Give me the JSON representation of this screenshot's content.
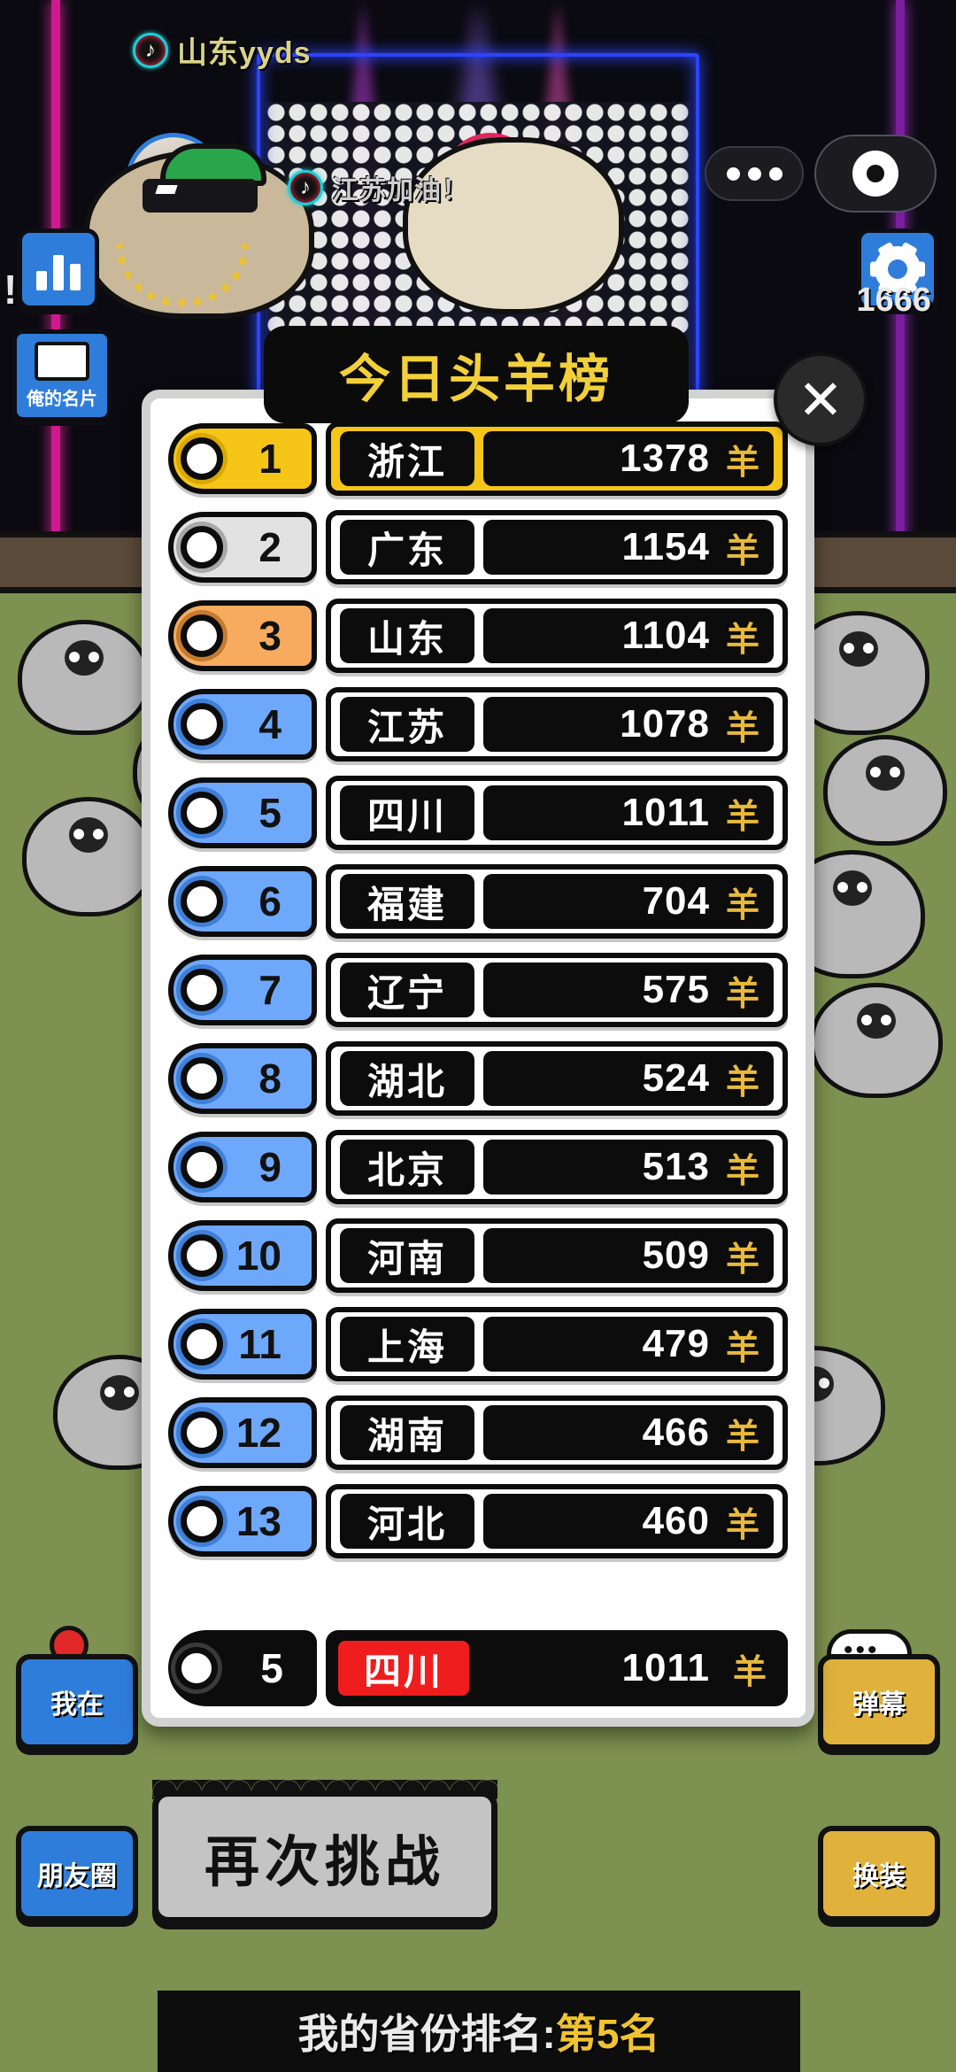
{
  "stage": {
    "tiktok_tag_top": "山东yyds",
    "tiktok_tag_bottom": "江苏加油！",
    "score_display": "1666",
    "exclaim": "!",
    "left_card_label": "俺的名片",
    "icons": {
      "chart": "chart-bar-icon",
      "gear": "gear-icon",
      "more": "more-dots-icon",
      "record": "record-button-icon"
    }
  },
  "modal": {
    "title": "今日头羊榜",
    "close_label": "✕",
    "unit": "羊",
    "colors": {
      "gold": "#f5c518",
      "silver": "#d9d9d9",
      "bronze": "#f5a košík",
      "blue": "#6ea8fa",
      "red": "#ef1d1d",
      "title_text": "#f2d03a"
    },
    "rows": [
      {
        "rank": "1",
        "province": "浙江",
        "score": "1378",
        "tier": "gold"
      },
      {
        "rank": "2",
        "province": "广东",
        "score": "1154",
        "tier": "silver"
      },
      {
        "rank": "3",
        "province": "山东",
        "score": "1104",
        "tier": "bronze"
      },
      {
        "rank": "4",
        "province": "江苏",
        "score": "1078",
        "tier": "blue"
      },
      {
        "rank": "5",
        "province": "四川",
        "score": "1011",
        "tier": "blue"
      },
      {
        "rank": "6",
        "province": "福建",
        "score": "704",
        "tier": "blue"
      },
      {
        "rank": "7",
        "province": "辽宁",
        "score": "575",
        "tier": "blue"
      },
      {
        "rank": "8",
        "province": "湖北",
        "score": "524",
        "tier": "blue"
      },
      {
        "rank": "9",
        "province": "北京",
        "score": "513",
        "tier": "blue"
      },
      {
        "rank": "10",
        "province": "河南",
        "score": "509",
        "tier": "blue"
      },
      {
        "rank": "11",
        "province": "上海",
        "score": "479",
        "tier": "blue"
      },
      {
        "rank": "12",
        "province": "湖南",
        "score": "466",
        "tier": "blue"
      },
      {
        "rank": "13",
        "province": "河北",
        "score": "460",
        "tier": "blue"
      }
    ],
    "own_row": {
      "rank": "5",
      "province": "四川",
      "score": "1011"
    }
  },
  "actions": {
    "retry": "再次挑战",
    "location": "我在",
    "barrage": "弹幕",
    "friends": "朋友圈",
    "dress": "换装"
  },
  "footer": {
    "label": "我的省份排名:",
    "value": "第5名"
  }
}
